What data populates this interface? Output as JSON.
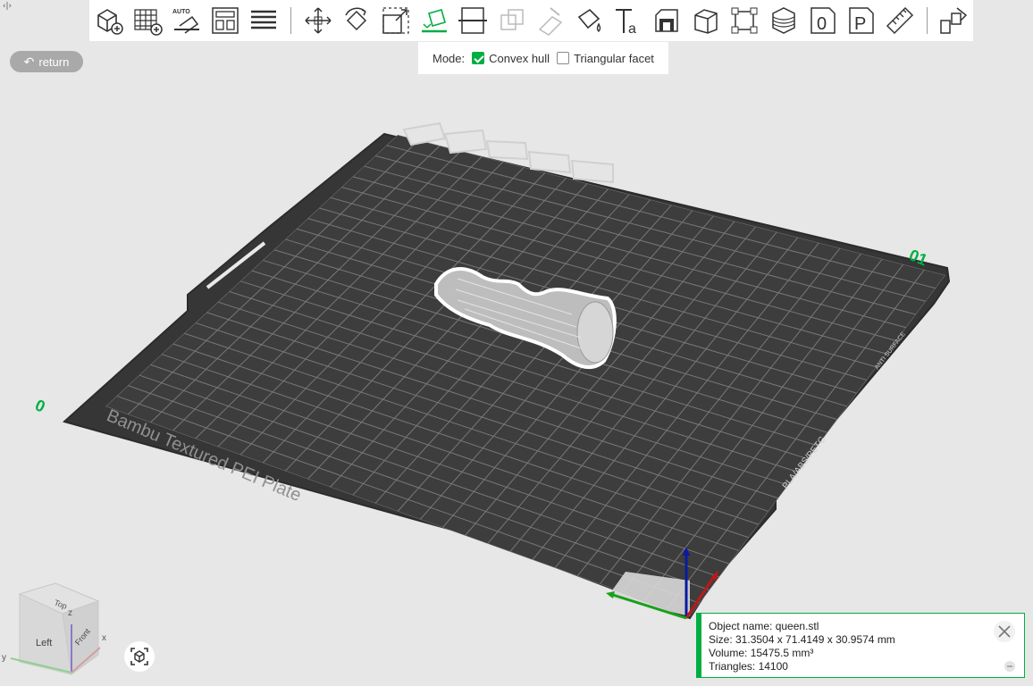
{
  "toolbar": {
    "tools": [
      {
        "name": "add-object-icon"
      },
      {
        "name": "add-plate-icon"
      },
      {
        "name": "auto-orient-icon",
        "text": "AUTO"
      },
      {
        "name": "arrange-icon"
      },
      {
        "name": "split-layers-icon"
      },
      {
        "name": "move-icon"
      },
      {
        "name": "rotate-icon"
      },
      {
        "name": "scale-icon"
      },
      {
        "name": "lay-on-face-icon"
      },
      {
        "name": "cut-icon"
      },
      {
        "name": "boolean-icon"
      },
      {
        "name": "support-paint-icon"
      },
      {
        "name": "color-paint-icon"
      },
      {
        "name": "text-icon",
        "text": "Ta"
      },
      {
        "name": "seam-paint-icon"
      },
      {
        "name": "fuzzy-skin-icon"
      },
      {
        "name": "assembly-icon"
      },
      {
        "name": "variable-layer-icon"
      },
      {
        "name": "object-zero-icon",
        "text": "0"
      },
      {
        "name": "plate-p-icon",
        "text": "P"
      },
      {
        "name": "measure-icon"
      },
      {
        "name": "assemble-view-icon"
      }
    ]
  },
  "mode_panel": {
    "label": "Mode:",
    "options": [
      {
        "label": "Convex hull",
        "checked": true
      },
      {
        "label": "Triangular facet",
        "checked": false
      }
    ]
  },
  "return_label": "return",
  "plate": {
    "label": "Bambu Textured PEI Plate",
    "index_front": "0",
    "index_back": "01",
    "filament_label": "PLA/ABS/PETG",
    "surface_label": "ANTI SURFACE"
  },
  "viewcube": {
    "top": "Top",
    "left": "Left",
    "front": "Front",
    "x": "x",
    "y": "y",
    "z": "z"
  },
  "info": {
    "object_name": "Object name: queen.stl",
    "size": "Size: 31.3504 x 71.4149 x 30.9574 mm",
    "volume": "Volume: 15475.5 mm³",
    "triangles": "Triangles: 14100"
  },
  "colors": {
    "accent": "#00ae42",
    "plate": "#3c3d3c",
    "grid": "#8b8d8b"
  }
}
